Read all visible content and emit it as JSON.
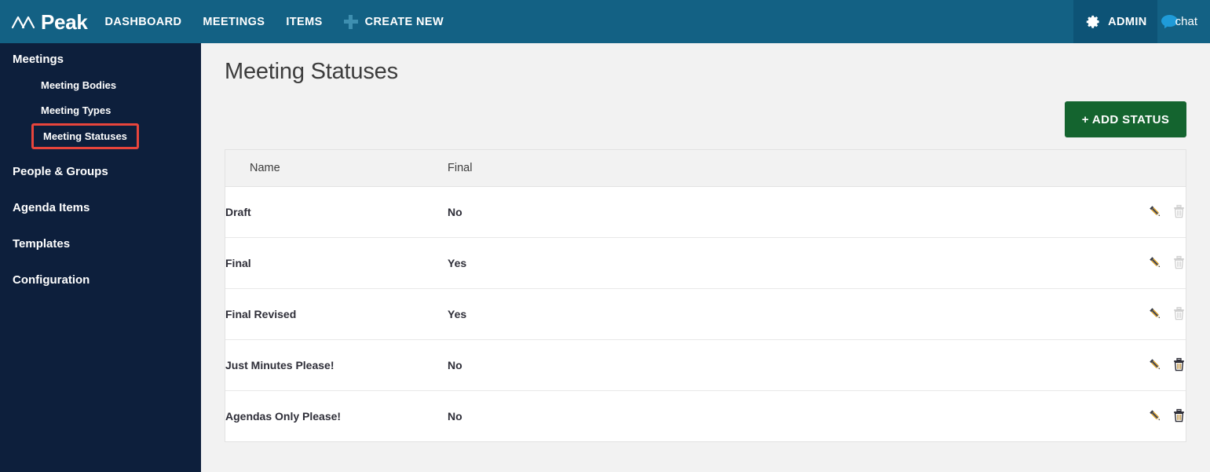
{
  "topbar": {
    "brand": "Peak",
    "brand_logo_icon": "peak-chart-icon",
    "nav": [
      {
        "label": "DASHBOARD"
      },
      {
        "label": "MEETINGS"
      },
      {
        "label": "ITEMS"
      }
    ],
    "create_new": {
      "icon": "plus-icon",
      "label": "CREATE NEW"
    },
    "admin": {
      "icon": "gear-icon",
      "label": "ADMIN"
    },
    "chat": {
      "icon": "chat-bubble-icon",
      "label": "chat"
    },
    "bg_color": "#136184",
    "admin_bg_color": "#0d5376",
    "accent_color": "#3e8fb0"
  },
  "sidebar": {
    "bg_color": "#0d1f3c",
    "highlight_color": "#e8453c",
    "items": [
      {
        "label": "Meetings",
        "level": "top"
      },
      {
        "label": "Meeting Bodies",
        "level": "sub"
      },
      {
        "label": "Meeting Types",
        "level": "sub"
      },
      {
        "label": "Meeting Statuses",
        "level": "sub",
        "highlighted": true
      },
      {
        "label": "People & Groups",
        "level": "top"
      },
      {
        "label": "Agenda Items",
        "level": "top"
      },
      {
        "label": "Templates",
        "level": "top"
      },
      {
        "label": "Configuration",
        "level": "top"
      }
    ]
  },
  "main": {
    "title": "Meeting Statuses",
    "add_button": {
      "label": "+ ADD STATUS",
      "color": "#14642f"
    },
    "table": {
      "columns": [
        "Name",
        "Final",
        ""
      ],
      "rows": [
        {
          "name": "Draft",
          "final": "No",
          "edit_icon": "pencil-icon",
          "delete_icon": "trash-icon",
          "delete_enabled": false
        },
        {
          "name": "Final",
          "final": "Yes",
          "edit_icon": "pencil-icon",
          "delete_icon": "trash-icon",
          "delete_enabled": false
        },
        {
          "name": "Final Revised",
          "final": "Yes",
          "edit_icon": "pencil-icon",
          "delete_icon": "trash-icon",
          "delete_enabled": false
        },
        {
          "name": "Just Minutes Please!",
          "final": "No",
          "edit_icon": "pencil-icon",
          "delete_icon": "trash-icon",
          "delete_enabled": true
        },
        {
          "name": "Agendas Only Please!",
          "final": "No",
          "edit_icon": "pencil-icon",
          "delete_icon": "trash-icon",
          "delete_enabled": true
        }
      ]
    }
  }
}
